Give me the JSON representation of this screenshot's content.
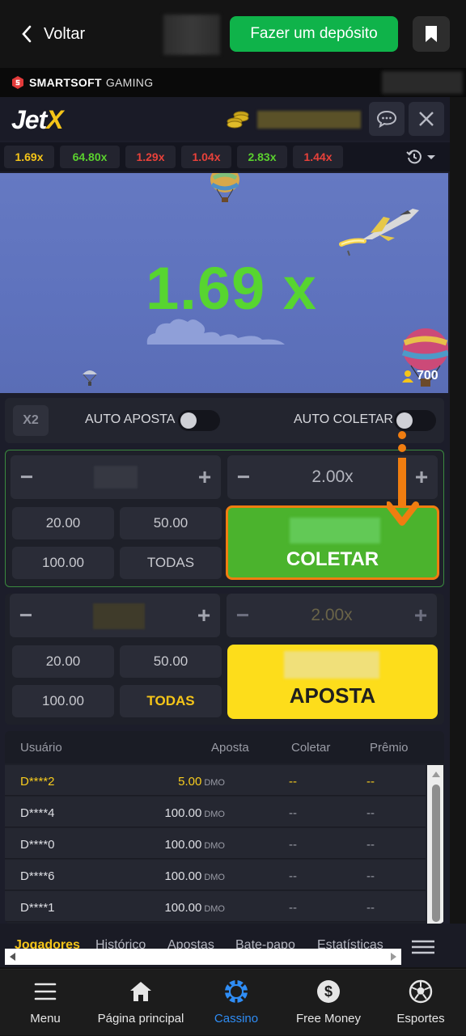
{
  "header": {
    "back_label": "Voltar",
    "deposit_label": "Fazer um depósito"
  },
  "provider": {
    "brand_bold": "SMARTSOFT",
    "brand_thin": "GAMING"
  },
  "game": {
    "logo_main": "Jet",
    "logo_accent": "X",
    "history": [
      "1.69x",
      "64.80x",
      "1.29x",
      "1.04x",
      "2.83x",
      "1.44x"
    ],
    "history_colors": [
      "#f5c518",
      "#5ad02e",
      "#e8413a",
      "#e8413a",
      "#5ad02e",
      "#e8413a"
    ],
    "multiplier": "1.69 x",
    "players_online": "700"
  },
  "controls": {
    "x2_label": "X2",
    "auto_bet_label": "AUTO APOSTA",
    "auto_collect_label": "AUTO COLETAR",
    "panel1": {
      "multiplier_value": "2.00x",
      "quick": [
        "20.00",
        "50.00",
        "100.00",
        "TODAS"
      ],
      "action_label": "COLETAR"
    },
    "panel2": {
      "multiplier_value": "2.00x",
      "quick": [
        "20.00",
        "50.00",
        "100.00",
        "TODAS"
      ],
      "action_label": "APOSTA"
    }
  },
  "players_table": {
    "headers": [
      "Usuário",
      "Aposta",
      "Coletar",
      "Prêmio"
    ],
    "currency": "DMO",
    "rows": [
      {
        "user": "D****2",
        "bet": "5.00",
        "collect": "--",
        "prize": "--"
      },
      {
        "user": "D****4",
        "bet": "100.00",
        "collect": "--",
        "prize": "--"
      },
      {
        "user": "D****0",
        "bet": "100.00",
        "collect": "--",
        "prize": "--"
      },
      {
        "user": "D****6",
        "bet": "100.00",
        "collect": "--",
        "prize": "--"
      },
      {
        "user": "D****1",
        "bet": "100.00",
        "collect": "--",
        "prize": "--"
      }
    ]
  },
  "tabs": [
    "Jogadores",
    "Histórico",
    "Apostas",
    "Bate-papo",
    "Estatísticas"
  ],
  "bottom_nav": [
    "Menu",
    "Página principal",
    "Cassino",
    "Free Money",
    "Esportes"
  ],
  "colors": {
    "deposit_green": "#0fb34a",
    "multiplier_green": "#57d530",
    "collect_green": "#4bb32d",
    "collect_border": "#f07d10",
    "bet_yellow": "#fddd1b",
    "active_nav_blue": "#2f8df5"
  }
}
